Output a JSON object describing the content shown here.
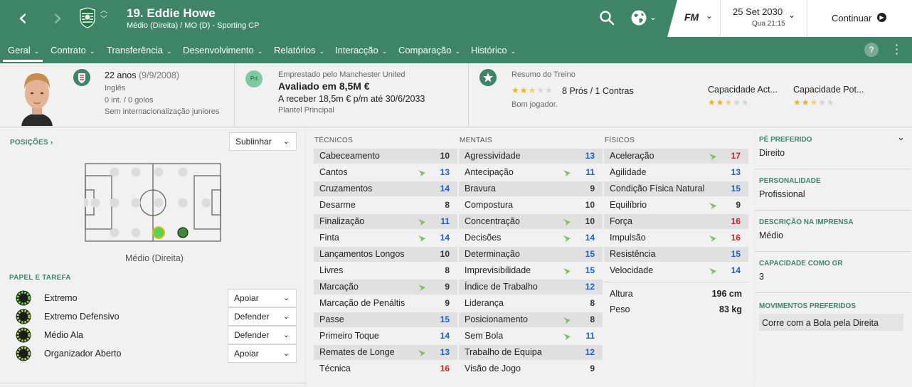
{
  "header": {
    "player_title": "19. Eddie Howe",
    "player_subtitle": "Médio (Direita) / MO (D) - Sporting CP",
    "date": "25 Set 2030",
    "time": "Qua 21:15",
    "fm_logo": "FM",
    "continue_label": "Continuar",
    "icons": [
      "back-arrow-icon",
      "forward-arrow-icon",
      "club-crest-icon",
      "up-down-icon",
      "search-icon",
      "globe-icon",
      "fm-menu-icon",
      "continue-arrow-icon"
    ]
  },
  "menu": {
    "items": [
      {
        "label": "Geral",
        "chevron": "⌄"
      },
      {
        "label": "Contrato",
        "chevron": "⌄"
      },
      {
        "label": "Transferência",
        "chevron": "⌄"
      },
      {
        "label": "Desenvolvimento",
        "chevron": "⌄"
      },
      {
        "label": "Relatórios",
        "chevron": "⌄"
      },
      {
        "label": "Interacção",
        "chevron": "⌄"
      },
      {
        "label": "Comparação",
        "chevron": "⌄"
      },
      {
        "label": "Histórico",
        "chevron": "⌄"
      }
    ],
    "active_index": 0,
    "help_label": "?"
  },
  "info": {
    "age": "22 anos",
    "birthdate": "(9/9/2008)",
    "nationality": "Inglês",
    "caps": "0 int. / 0 golos",
    "youth_caps": "Sem internacionalização juniores",
    "loan_badge": "Prt",
    "loan_from": "Emprestado pelo Manchester United",
    "value": "Avaliado em 8,5M €",
    "wage": "A receber 18,5m € p/m até 30/6/2033",
    "squad": "Plantel Principal",
    "training_title": "Resumo do Treino",
    "training_summary": "8 Prós / 1 Contras",
    "training_rating": 2.5,
    "training_note": "Bom jogador.",
    "current_ability_label": "Capacidade Act...",
    "current_ability_stars": 2.5,
    "potential_ability_label": "Capacidade Pot...",
    "potential_ability_stars": 2.5
  },
  "positions": {
    "heading": "POSIÇÕES ›",
    "highlight_button": "Sublinhar",
    "position_label": "Médio (Direita)"
  },
  "roles": {
    "heading": "PAPEL E TAREFA",
    "items": [
      {
        "name": "Extremo",
        "duty": "Apoiar"
      },
      {
        "name": "Extremo Defensivo",
        "duty": "Defender"
      },
      {
        "name": "Médio Ala",
        "duty": "Defender"
      },
      {
        "name": "Organizador Aberto",
        "duty": "Apoiar"
      }
    ]
  },
  "attributes": {
    "technical_heading": "TÉCNICOS",
    "mental_heading": "MENTAIS",
    "physical_heading": "FÍSICOS",
    "technical": [
      {
        "name": "Cabeceamento",
        "value": 10,
        "arrow": false
      },
      {
        "name": "Cantos",
        "value": 13,
        "arrow": true
      },
      {
        "name": "Cruzamentos",
        "value": 14,
        "arrow": false
      },
      {
        "name": "Desarme",
        "value": 8,
        "arrow": false
      },
      {
        "name": "Finalização",
        "value": 11,
        "arrow": true
      },
      {
        "name": "Finta",
        "value": 14,
        "arrow": true
      },
      {
        "name": "Lançamentos Longos",
        "value": 10,
        "arrow": false
      },
      {
        "name": "Livres",
        "value": 8,
        "arrow": false
      },
      {
        "name": "Marcação",
        "value": 9,
        "arrow": true
      },
      {
        "name": "Marcação de Penáltis",
        "value": 9,
        "arrow": false
      },
      {
        "name": "Passe",
        "value": 15,
        "arrow": false
      },
      {
        "name": "Primeiro Toque",
        "value": 14,
        "arrow": false
      },
      {
        "name": "Remates de Longe",
        "value": 13,
        "arrow": true
      },
      {
        "name": "Técnica",
        "value": 16,
        "arrow": false
      }
    ],
    "mental": [
      {
        "name": "Agressividade",
        "value": 13,
        "arrow": false
      },
      {
        "name": "Antecipação",
        "value": 11,
        "arrow": true
      },
      {
        "name": "Bravura",
        "value": 9,
        "arrow": false
      },
      {
        "name": "Compostura",
        "value": 10,
        "arrow": false
      },
      {
        "name": "Concentração",
        "value": 10,
        "arrow": true
      },
      {
        "name": "Decisões",
        "value": 14,
        "arrow": true
      },
      {
        "name": "Determinação",
        "value": 15,
        "arrow": false
      },
      {
        "name": "Imprevisibilidade",
        "value": 15,
        "arrow": true
      },
      {
        "name": "Índice de Trabalho",
        "value": 12,
        "arrow": false
      },
      {
        "name": "Liderança",
        "value": 8,
        "arrow": false
      },
      {
        "name": "Posicionamento",
        "value": 8,
        "arrow": true
      },
      {
        "name": "Sem Bola",
        "value": 11,
        "arrow": true
      },
      {
        "name": "Trabalho de Equipa",
        "value": 12,
        "arrow": false
      },
      {
        "name": "Visão de Jogo",
        "value": 9,
        "arrow": false
      }
    ],
    "physical": [
      {
        "name": "Aceleração",
        "value": 17,
        "arrow": true
      },
      {
        "name": "Agilidade",
        "value": 13,
        "arrow": false
      },
      {
        "name": "Condição Física Natural",
        "value": 15,
        "arrow": false
      },
      {
        "name": "Equilíbrio",
        "value": 9,
        "arrow": true
      },
      {
        "name": "Força",
        "value": 16,
        "arrow": false
      },
      {
        "name": "Impulsão",
        "value": 16,
        "arrow": true
      },
      {
        "name": "Resistência",
        "value": 15,
        "arrow": false
      },
      {
        "name": "Velocidade",
        "value": 14,
        "arrow": true
      }
    ],
    "height_label": "Altura",
    "height": "196 cm",
    "weight_label": "Peso",
    "weight": "83 kg"
  },
  "details": {
    "preferred_foot_label": "PÉ PREFERIDO",
    "preferred_foot": "Direito",
    "personality_label": "PERSONALIDADE",
    "personality": "Profissional",
    "media_label": "DESCRIÇÃO NA IMPRENSA",
    "media": "Médio",
    "gk_label": "CAPACIDADE COMO GR",
    "gk": "3",
    "moves_label": "MOVIMENTOS PREFERIDOS",
    "move": "Corre com a Bola pela Direita"
  },
  "colors": {
    "brand_green": "#3e8568",
    "value_red": "#d81e1e",
    "value_blue": "#1a5fc8",
    "value_black": "#333333",
    "star": "#f2b01e",
    "arrow_green": "#7dc35b"
  }
}
